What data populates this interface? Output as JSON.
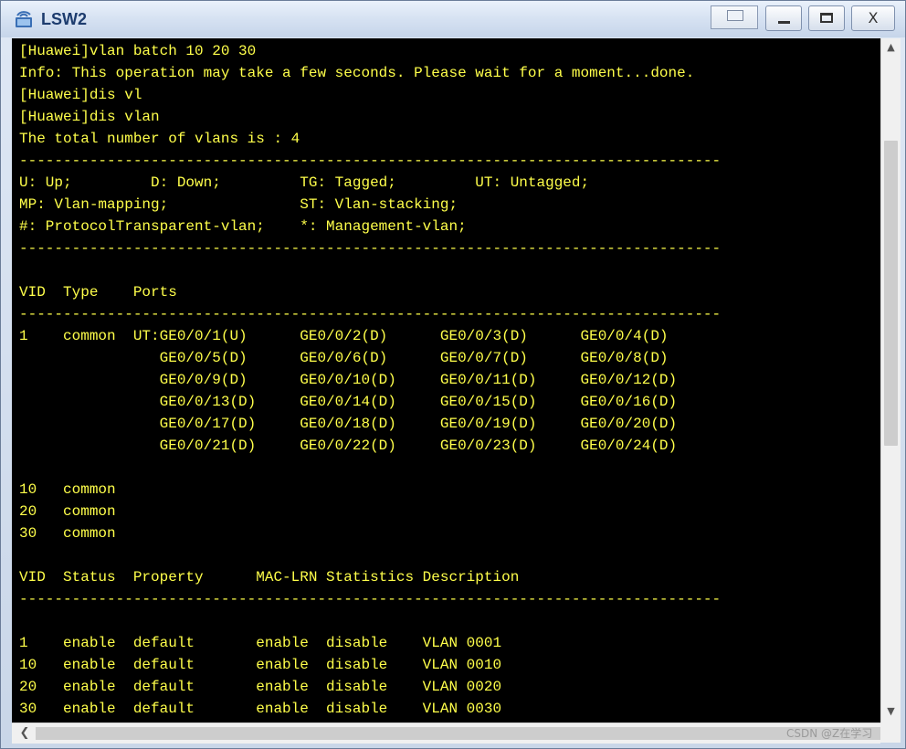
{
  "window": {
    "title": "LSW2",
    "buttons": {
      "minimize": "minimize",
      "maximize": "maximize",
      "close": "X"
    }
  },
  "terminal": {
    "text_color": "#ffff4a",
    "background": "#000000",
    "lines": [
      "[Huawei]vlan batch 10 20 30",
      "Info: This operation may take a few seconds. Please wait for a moment...done.",
      "[Huawei]dis vl",
      "[Huawei]dis vlan",
      "The total number of vlans is : 4",
      "--------------------------------------------------------------------------------",
      "U: Up;         D: Down;         TG: Tagged;         UT: Untagged;",
      "MP: Vlan-mapping;               ST: Vlan-stacking;",
      "#: ProtocolTransparent-vlan;    *: Management-vlan;",
      "--------------------------------------------------------------------------------",
      "",
      "VID  Type    Ports",
      "--------------------------------------------------------------------------------",
      "1    common  UT:GE0/0/1(U)      GE0/0/2(D)      GE0/0/3(D)      GE0/0/4(D)",
      "                GE0/0/5(D)      GE0/0/6(D)      GE0/0/7(D)      GE0/0/8(D)",
      "                GE0/0/9(D)      GE0/0/10(D)     GE0/0/11(D)     GE0/0/12(D)",
      "                GE0/0/13(D)     GE0/0/14(D)     GE0/0/15(D)     GE0/0/16(D)",
      "                GE0/0/17(D)     GE0/0/18(D)     GE0/0/19(D)     GE0/0/20(D)",
      "                GE0/0/21(D)     GE0/0/22(D)     GE0/0/23(D)     GE0/0/24(D)",
      "",
      "10   common",
      "20   common",
      "30   common",
      "",
      "VID  Status  Property      MAC-LRN Statistics Description",
      "--------------------------------------------------------------------------------",
      "",
      "1    enable  default       enable  disable    VLAN 0001",
      "10   enable  default       enable  disable    VLAN 0010",
      "20   enable  default       enable  disable    VLAN 0020",
      "30   enable  default       enable  disable    VLAN 0030"
    ]
  },
  "scrollbars": {
    "up_arrow": "^",
    "down_arrow": "v",
    "left_arrow": "<"
  },
  "watermark": "CSDN @Z在学习"
}
